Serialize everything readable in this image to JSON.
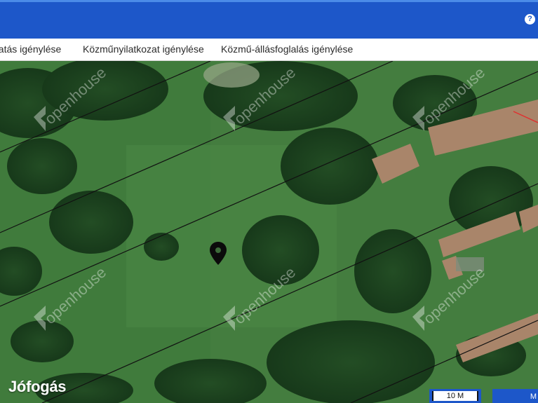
{
  "header": {
    "help_label": "?"
  },
  "tabs": [
    {
      "label": "gatás igénylése"
    },
    {
      "label": "Közműnyilatkozat igénylése"
    },
    {
      "label": "Közmű-állásfoglalás igénylése"
    }
  ],
  "map": {
    "watermark_text": "openhouse",
    "logo": "Jófogás",
    "scale_label": "10 M",
    "mode_label": "M",
    "marker_icon": "map-pin-icon"
  },
  "colors": {
    "header": "#1d57c9",
    "grass": "#3f7a3c",
    "tree": "#1f4a22",
    "roof": "#a9856a"
  }
}
